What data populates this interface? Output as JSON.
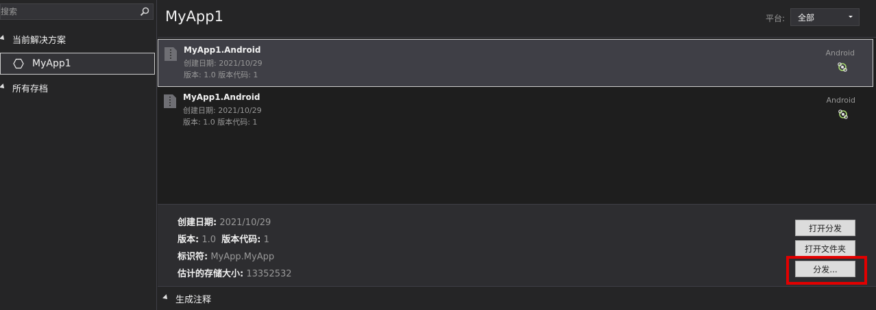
{
  "sidebar": {
    "search": {
      "placeholder": "搜索"
    },
    "current_solution_label": "当前解决方案",
    "selected_item": "MyApp1",
    "all_archives_label": "所有存档"
  },
  "header": {
    "title": "MyApp1",
    "platform_label": "平台:",
    "platform_value": "全部"
  },
  "archives": [
    {
      "name": "MyApp1.Android",
      "created": "创建日期: 2021/10/29",
      "version_line": "版本: 1.0    版本代码: 1",
      "platform": "Android",
      "selected": true
    },
    {
      "name": "MyApp1.Android",
      "created": "创建日期: 2021/10/29",
      "version_line": "版本: 1.0    版本代码: 1",
      "platform": "Android",
      "selected": false
    }
  ],
  "details": {
    "created_label": "创建日期:",
    "created_value": "2021/10/29",
    "version_label": "版本:",
    "version_value": "1.0",
    "version_code_label": "版本代码:",
    "version_code_value": "1",
    "identifier_label": "标识符:",
    "identifier_value": "MyApp.MyApp",
    "size_label": "估计的存储大小:",
    "size_value": "13352532"
  },
  "buttons": {
    "open_distribution": "打开分发",
    "open_folder": "打开文件夹",
    "distribute": "分发..."
  },
  "footer": {
    "build_notes_label": "生成注释"
  },
  "colors": {
    "background": "#252526",
    "list_background": "#1e1e1e",
    "highlight": "#e30000"
  }
}
